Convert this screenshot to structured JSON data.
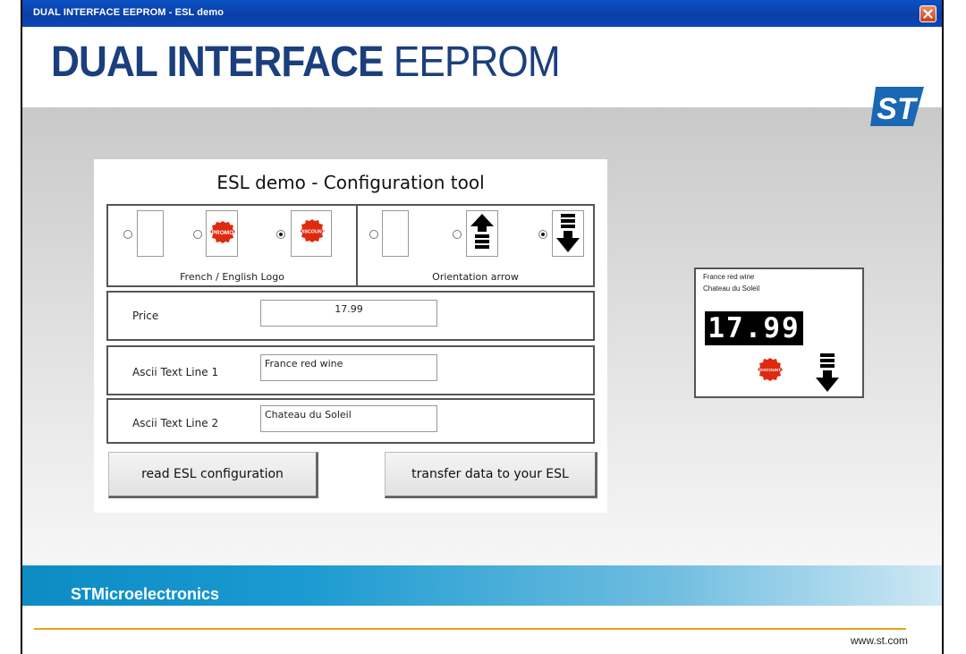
{
  "window": {
    "title": "DUAL INTERFACE EEPROM - ESL demo"
  },
  "header": {
    "title_bold": "DUAL INTERFACE",
    "title_thin": "EEPROM",
    "brand_logo": "ST"
  },
  "config_panel": {
    "title": "ESL demo - Configuration tool",
    "logo_group": {
      "label": "French / English Logo",
      "options": [
        {
          "icon": "blank-logo-icon",
          "selected": false
        },
        {
          "icon": "promo-logo-icon",
          "text": "PROMO",
          "selected": false
        },
        {
          "icon": "discount-logo-icon",
          "text": "DISCOUNT",
          "selected": true
        }
      ]
    },
    "arrow_group": {
      "label": "Orientation arrow",
      "options": [
        {
          "icon": "blank-arrow-icon",
          "selected": false
        },
        {
          "icon": "arrow-up-icon",
          "selected": false
        },
        {
          "icon": "arrow-down-icon",
          "selected": true
        }
      ]
    },
    "price": {
      "label": "Price",
      "value": "17.99"
    },
    "text_line_1": {
      "label": "Ascii Text Line 1",
      "value": "France red wine"
    },
    "text_line_2": {
      "label": "Ascii Text Line 2",
      "value": "Chateau du Soleil"
    },
    "buttons": {
      "read": "read ESL configuration",
      "transfer": "transfer data to your ESL"
    }
  },
  "preview": {
    "line1": "France red wine",
    "line2": "Chateau du Soleil",
    "price": "17.99",
    "logo": "DISCOUNT",
    "arrow": "arrow-down-icon"
  },
  "footer": {
    "brand": "STMicroelectronics",
    "url": "www.st.com"
  },
  "colors": {
    "title_blue": "#1b3f7d",
    "footer_blue": "#0d8cc4",
    "footer_line": "#e8a21a",
    "badge_red": "#e02a10"
  }
}
